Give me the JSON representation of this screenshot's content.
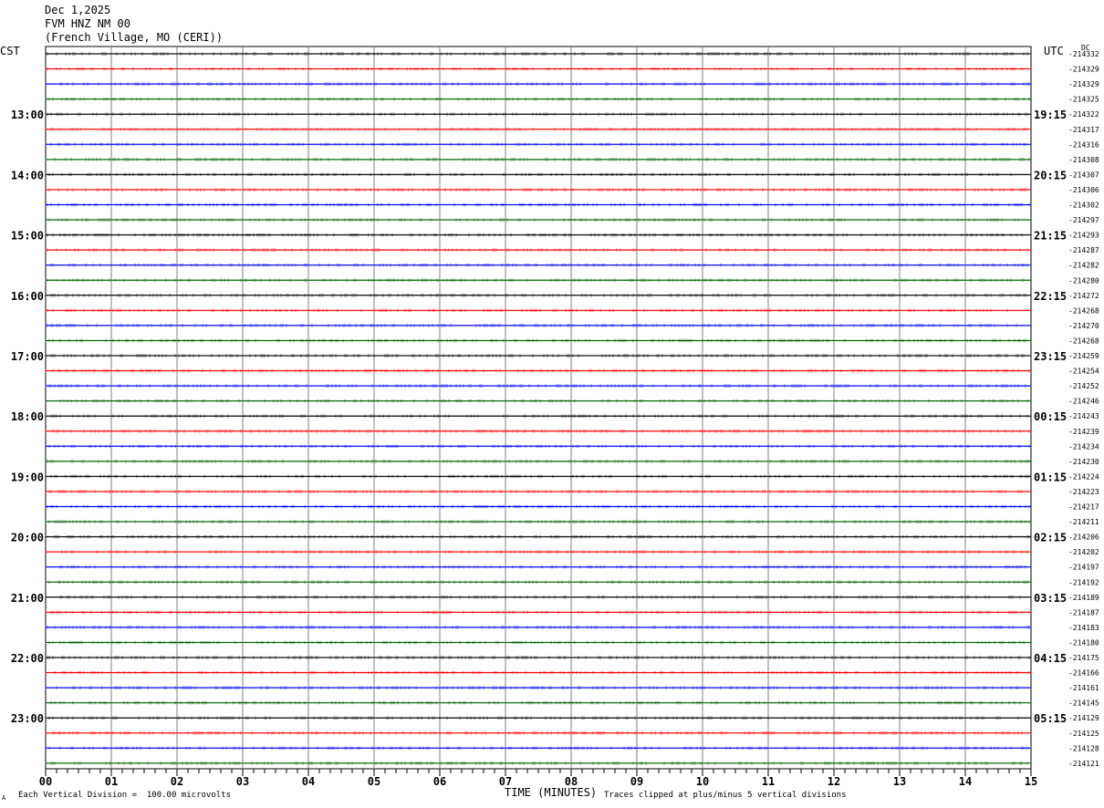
{
  "header": {
    "date": "Dec 1,2025",
    "station": "FVM HNZ NM 00",
    "location": "(French Village, MO (CERI))"
  },
  "left_zone": "CST",
  "right_zone": "UTC",
  "right_corner": "DC",
  "footer": {
    "scale_note": "Each Vertical Division =  100.00 microvolts",
    "clip_note": "Traces clipped at plus/minus 5 vertical divisions",
    "mark": "A"
  },
  "colors": {
    "trace_cycle": [
      "#000000",
      "#ff0000",
      "#0000ff",
      "#006400"
    ],
    "grid": "#808080"
  },
  "chart_data": {
    "type": "line",
    "title": "",
    "xlabel": "TIME (MINUTES)",
    "xlim": [
      0,
      15
    ],
    "x_ticks": [
      "00",
      "01",
      "02",
      "03",
      "04",
      "05",
      "06",
      "07",
      "08",
      "09",
      "10",
      "11",
      "12",
      "13",
      "14",
      "15"
    ],
    "rows_per_hour": 4,
    "left_hour_labels": [
      "13:00",
      "14:00",
      "15:00",
      "16:00",
      "17:00",
      "18:00",
      "19:00",
      "20:00",
      "21:00",
      "22:00",
      "23:00"
    ],
    "right_hour_labels": [
      "19:15",
      "20:15",
      "21:15",
      "22:15",
      "23:15",
      "00:15",
      "01:15",
      "02:15",
      "03:15",
      "04:15",
      "05:15"
    ],
    "trace_offsets": [
      "-214332",
      "-214329",
      "-214329",
      "-214325",
      "-214322",
      "-214317",
      "-214316",
      "-214308",
      "-214307",
      "-214306",
      "-214302",
      "-214297",
      "-214293",
      "-214287",
      "-214282",
      "-214280",
      "-214272",
      "-214268",
      "-214270",
      "-214268",
      "-214259",
      "-214254",
      "-214252",
      "-214246",
      "-214243",
      "-214239",
      "-214234",
      "-214230",
      "-214224",
      "-214223",
      "-214217",
      "-214211",
      "-214206",
      "-214202",
      "-214197",
      "-214192",
      "-214189",
      "-214187",
      "-214183",
      "-214180",
      "-214175",
      "-214166",
      "-214161",
      "-214145",
      "-214129",
      "-214125",
      "-214128",
      "-214121"
    ],
    "grid": true
  }
}
